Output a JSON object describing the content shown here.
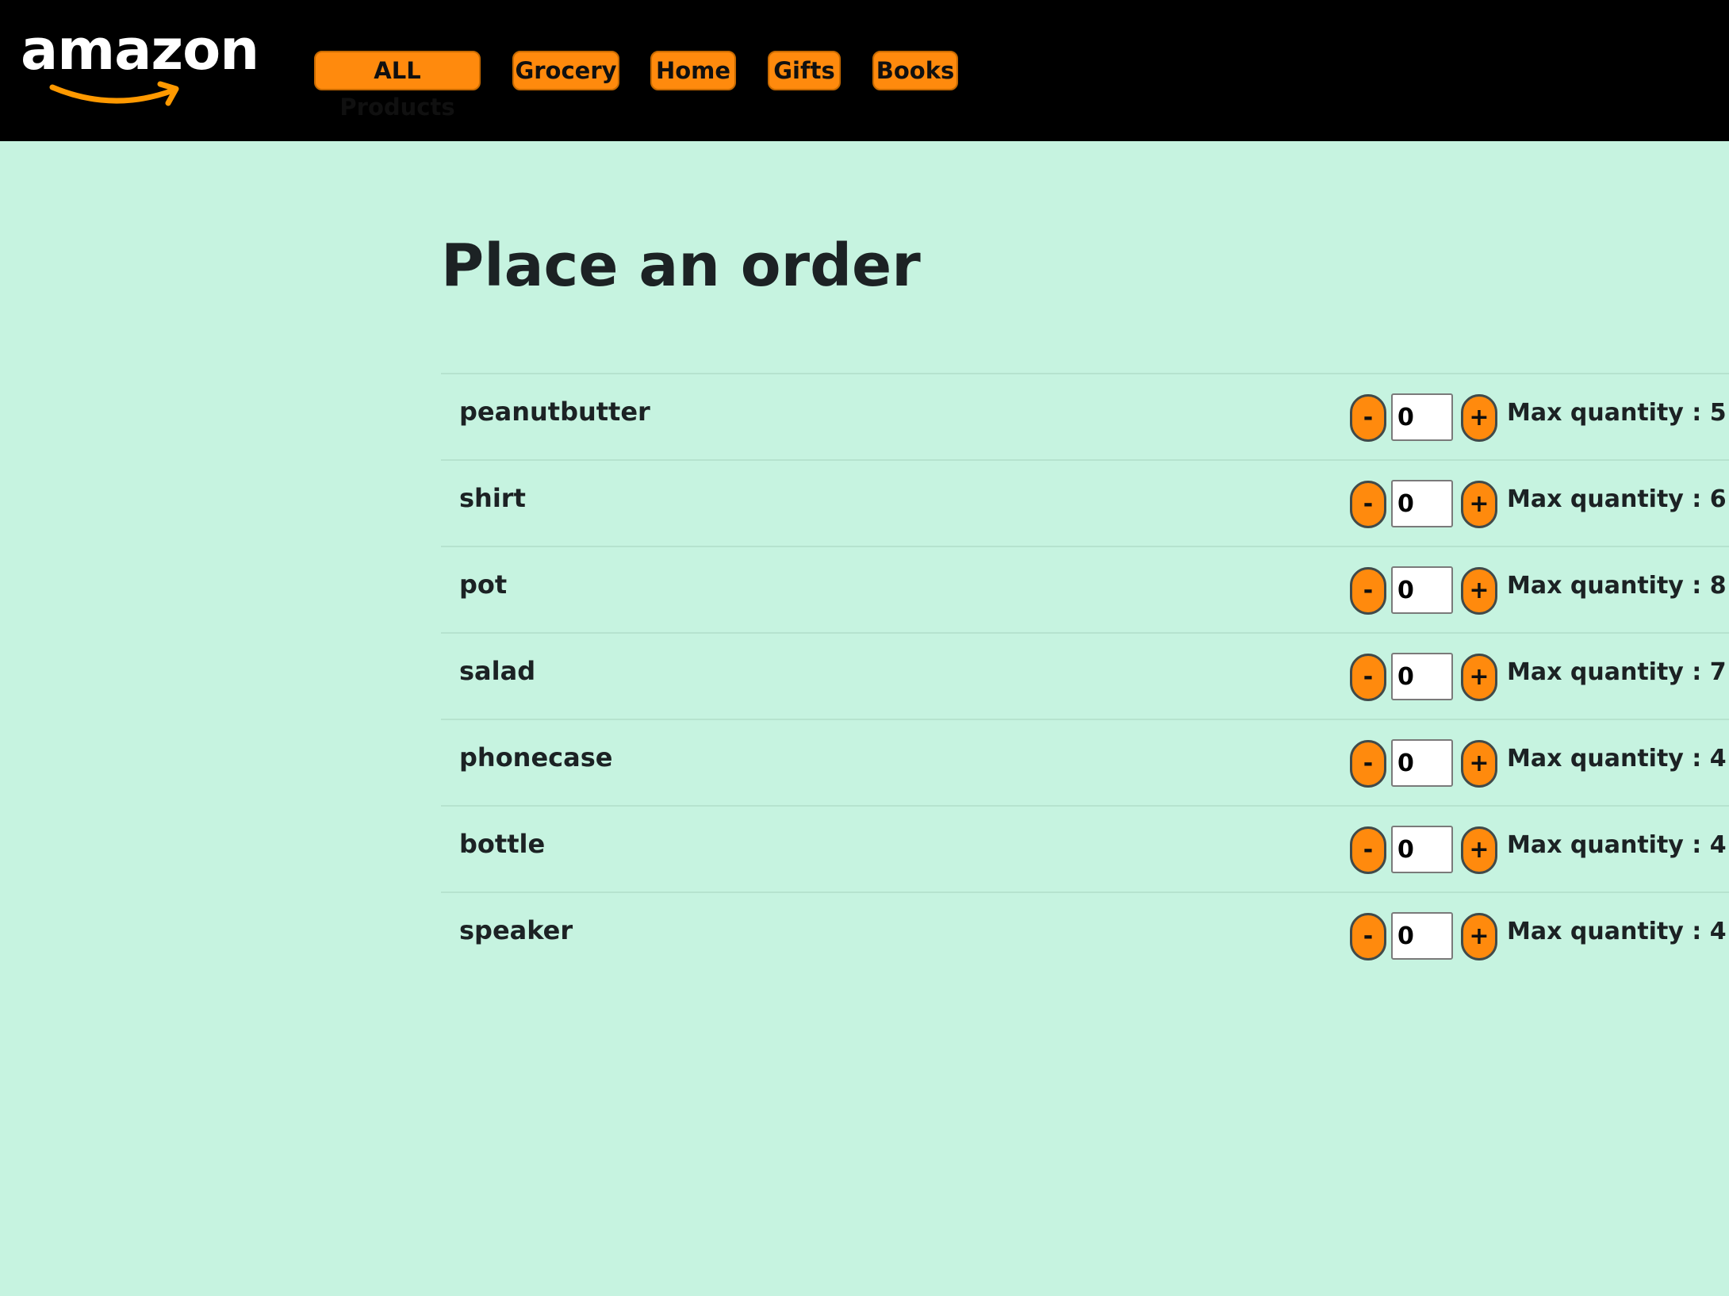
{
  "brand": {
    "logo_text": "amazon",
    "accent_color": "#ff8a0d",
    "background_color": "#c6f3e0"
  },
  "nav": {
    "items": [
      {
        "label": "ALL Products"
      },
      {
        "label": "Grocery"
      },
      {
        "label": "Home"
      },
      {
        "label": "Gifts"
      },
      {
        "label": "Books"
      }
    ]
  },
  "page": {
    "title": "Place an order"
  },
  "order": {
    "minus_label": "-",
    "plus_label": "+",
    "items": [
      {
        "name": "peanutbutter",
        "quantity": "0",
        "max_label": "Max quantity : 5"
      },
      {
        "name": "shirt",
        "quantity": "0",
        "max_label": "Max quantity : 6"
      },
      {
        "name": "pot",
        "quantity": "0",
        "max_label": "Max quantity : 8"
      },
      {
        "name": "salad",
        "quantity": "0",
        "max_label": "Max quantity : 7"
      },
      {
        "name": "phonecase",
        "quantity": "0",
        "max_label": "Max quantity : 4"
      },
      {
        "name": "bottle",
        "quantity": "0",
        "max_label": "Max quantity : 4"
      },
      {
        "name": "speaker",
        "quantity": "0",
        "max_label": "Max quantity : 4"
      }
    ]
  }
}
